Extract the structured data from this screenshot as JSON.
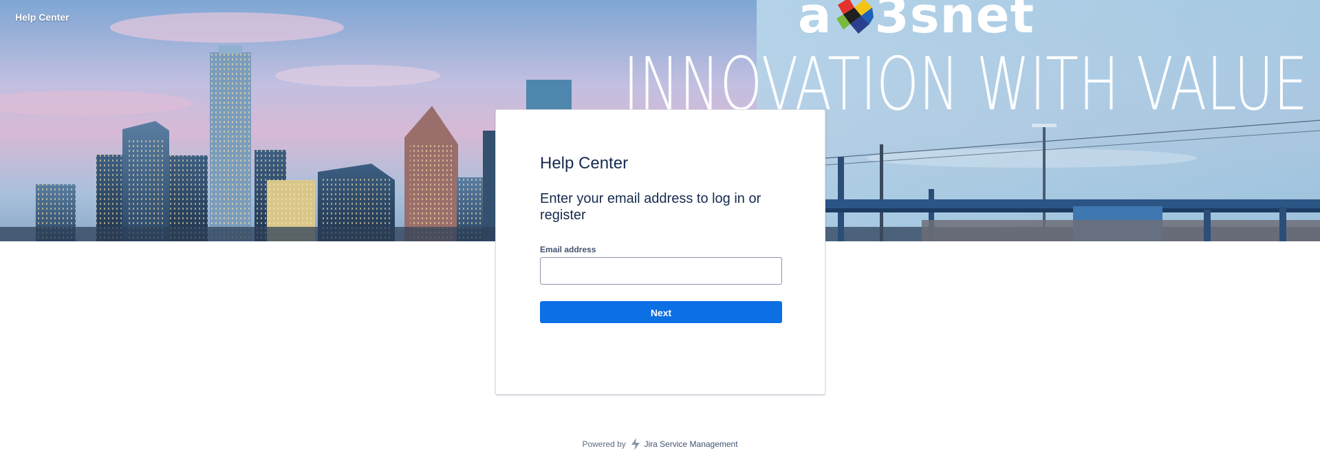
{
  "header": {
    "site_title": "Help Center"
  },
  "banner": {
    "brand_name_left": "a",
    "brand_name_right": "3snet",
    "tagline": "INNOVATION WITH VALUE"
  },
  "login_card": {
    "title": "Help Center",
    "subtitle": "Enter your email address to log in or register",
    "email_label": "Email address",
    "email_value": "",
    "email_placeholder": "",
    "next_label": "Next"
  },
  "footer": {
    "powered_by": "Powered by",
    "product_name": "Jira Service Management"
  },
  "colors": {
    "primary_button": "#0c6fe4",
    "heading_text": "#172b4d",
    "footer_text": "#5e6c84"
  },
  "icons": {
    "brand_logo": "multicolor-cube-icon",
    "footer_logo": "jira-service-management-icon"
  }
}
